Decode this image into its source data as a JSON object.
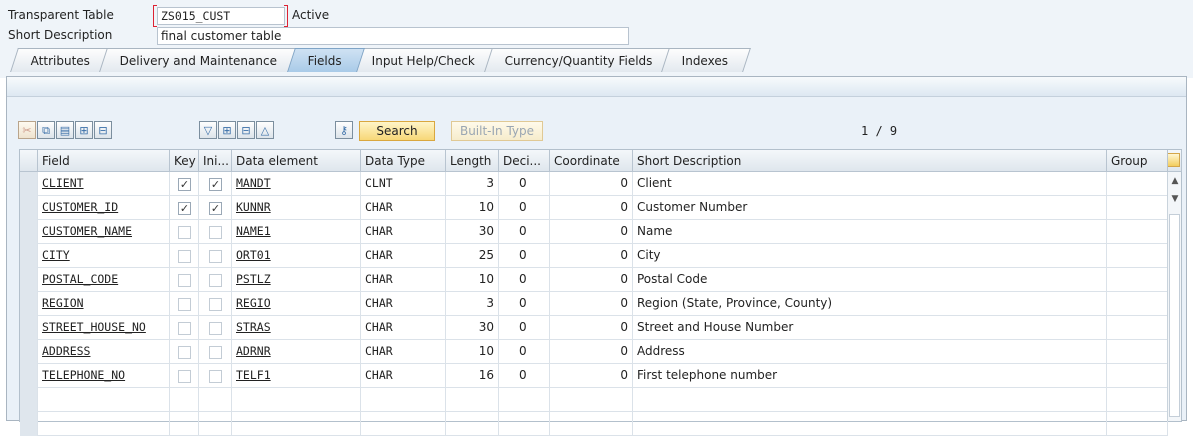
{
  "header": {
    "table_label": "Transparent Table",
    "table_value": "ZS015_CUST",
    "status": "Active",
    "desc_label": "Short Description",
    "desc_value": "final customer table"
  },
  "tabs": [
    {
      "label": "Attributes"
    },
    {
      "label": "Delivery and Maintenance"
    },
    {
      "label": "Fields",
      "active": true
    },
    {
      "label": "Input Help/Check"
    },
    {
      "label": "Currency/Quantity Fields"
    },
    {
      "label": "Indexes"
    }
  ],
  "toolbar": {
    "search_label": "Search",
    "builtin_label": "Built-In Type",
    "pager": "1 / 9",
    "icons": [
      "cut-icon",
      "copy-icon",
      "paste-icon",
      "insert-row-icon",
      "delete-row-icon",
      "filter-down-icon",
      "expand-icon",
      "collapse-icon",
      "filter-up-icon",
      "key-icon"
    ]
  },
  "table": {
    "columns": [
      "Field",
      "Key",
      "Ini...",
      "Data element",
      "Data Type",
      "Length",
      "Deci...",
      "Coordinate",
      "Short Description",
      "Group"
    ],
    "rows": [
      {
        "field": "CLIENT",
        "key": true,
        "ini": true,
        "element": "MANDT",
        "type": "CLNT",
        "length": "3",
        "deci": "0",
        "coord": "0",
        "desc": "Client"
      },
      {
        "field": "CUSTOMER_ID",
        "key": true,
        "ini": true,
        "element": "KUNNR",
        "type": "CHAR",
        "length": "10",
        "deci": "0",
        "coord": "0",
        "desc": "Customer Number"
      },
      {
        "field": "CUSTOMER_NAME",
        "key": false,
        "ini": false,
        "element": "NAME1",
        "type": "CHAR",
        "length": "30",
        "deci": "0",
        "coord": "0",
        "desc": "Name"
      },
      {
        "field": "CITY",
        "key": false,
        "ini": false,
        "element": "ORT01",
        "type": "CHAR",
        "length": "25",
        "deci": "0",
        "coord": "0",
        "desc": "City"
      },
      {
        "field": "POSTAL_CODE",
        "key": false,
        "ini": false,
        "element": "PSTLZ",
        "type": "CHAR",
        "length": "10",
        "deci": "0",
        "coord": "0",
        "desc": "Postal Code"
      },
      {
        "field": "REGION",
        "key": false,
        "ini": false,
        "element": "REGIO",
        "type": "CHAR",
        "length": "3",
        "deci": "0",
        "coord": "0",
        "desc": "Region (State, Province, County)"
      },
      {
        "field": "STREET_HOUSE_NO",
        "key": false,
        "ini": false,
        "element": "STRAS",
        "type": "CHAR",
        "length": "30",
        "deci": "0",
        "coord": "0",
        "desc": "Street and House Number"
      },
      {
        "field": "ADDRESS",
        "key": false,
        "ini": false,
        "element": "ADRNR",
        "type": "CHAR",
        "length": "10",
        "deci": "0",
        "coord": "0",
        "desc": "Address"
      },
      {
        "field": "TELEPHONE_NO",
        "key": false,
        "ini": false,
        "element": "TELF1",
        "type": "CHAR",
        "length": "16",
        "deci": "0",
        "coord": "0",
        "desc": "First telephone number"
      }
    ]
  },
  "colors": {
    "background": "#eff4f9",
    "active_tab": "#a9cbe8",
    "button": "#f7d778",
    "required_marker": "#dd2233"
  }
}
